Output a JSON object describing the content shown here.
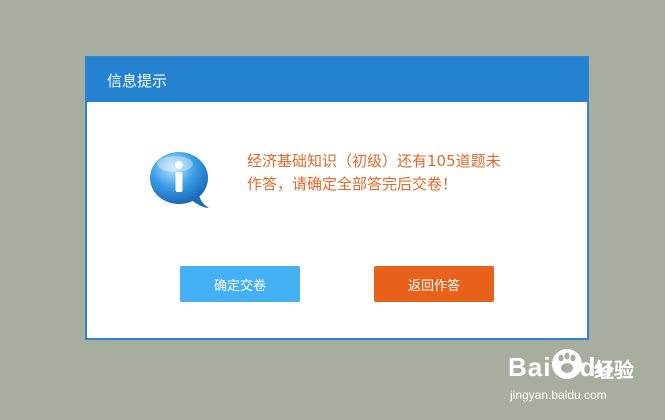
{
  "dialog": {
    "title": "信息提示",
    "icon": "info-speech-bubble-icon",
    "message_line1": "经济基础知识（初级）还有105道题未",
    "message_line2": "作答，请确定全部答完后交卷！",
    "confirm_label": "确定交卷",
    "back_label": "返回作答"
  },
  "watermark": {
    "logo_text": "Bai",
    "logo_suffix": "du",
    "product": "经验",
    "url": "jingyan.baidu.com"
  },
  "colors": {
    "background": "#a8ae9f",
    "header": "#2582d0",
    "message": "#e06a2a",
    "confirm_button": "#45b1f5",
    "back_button": "#e8621c"
  }
}
